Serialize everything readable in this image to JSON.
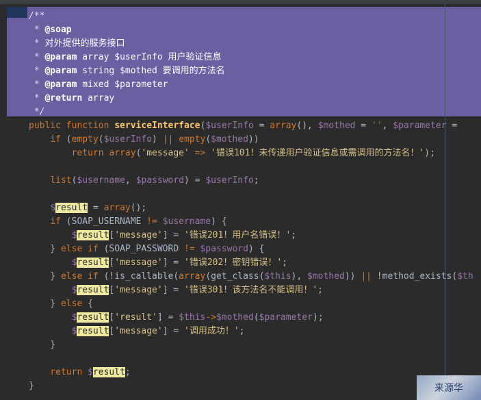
{
  "editor": {
    "lines": [
      [
        {
          "t": "/**",
          "c": "doc"
        }
      ],
      [
        {
          "t": " * ",
          "c": "star"
        },
        {
          "t": "@soap",
          "c": "tag"
        }
      ],
      [
        {
          "t": " * ",
          "c": "star"
        },
        {
          "t": "对外提供的服务接口",
          "c": "dtext"
        }
      ],
      [
        {
          "t": " * ",
          "c": "star"
        },
        {
          "t": "@param",
          "c": "tag"
        },
        {
          "t": " array $userInfo 用户验证信息",
          "c": "dtext"
        }
      ],
      [
        {
          "t": " * ",
          "c": "star"
        },
        {
          "t": "@param",
          "c": "tag"
        },
        {
          "t": " string $mothed 要调用的方法名",
          "c": "dtext"
        }
      ],
      [
        {
          "t": " * ",
          "c": "star"
        },
        {
          "t": "@param",
          "c": "tag"
        },
        {
          "t": " mixed $parameter",
          "c": "dtext"
        }
      ],
      [
        {
          "t": " * ",
          "c": "star"
        },
        {
          "t": "@return",
          "c": "tag"
        },
        {
          "t": " array",
          "c": "dtext"
        }
      ],
      [
        {
          "t": " */",
          "c": "doc"
        }
      ],
      [
        {
          "t": "public function ",
          "c": "kw"
        },
        {
          "t": "serviceInterface",
          "c": "fn"
        },
        {
          "t": "(",
          "c": "plain"
        },
        {
          "t": "$userInfo",
          "c": "var"
        },
        {
          "t": " = ",
          "c": "plain"
        },
        {
          "t": "array",
          "c": "kw"
        },
        {
          "t": "(), ",
          "c": "plain"
        },
        {
          "t": "$mothed",
          "c": "var"
        },
        {
          "t": " = ",
          "c": "plain"
        },
        {
          "t": "''",
          "c": "str"
        },
        {
          "t": ", ",
          "c": "plain"
        },
        {
          "t": "$parameter",
          "c": "var"
        },
        {
          "t": " = ",
          "c": "plain"
        }
      ],
      [
        {
          "t": "    ",
          "c": "plain"
        },
        {
          "t": "if",
          "c": "kw"
        },
        {
          "t": " (",
          "c": "plain"
        },
        {
          "t": "empty",
          "c": "kw"
        },
        {
          "t": "(",
          "c": "plain"
        },
        {
          "t": "$userInfo",
          "c": "var"
        },
        {
          "t": ") ",
          "c": "plain"
        },
        {
          "t": "||",
          "c": "punc"
        },
        {
          "t": " ",
          "c": "plain"
        },
        {
          "t": "empty",
          "c": "kw"
        },
        {
          "t": "(",
          "c": "plain"
        },
        {
          "t": "$mothed",
          "c": "var"
        },
        {
          "t": "))",
          "c": "plain"
        }
      ],
      [
        {
          "t": "        ",
          "c": "plain"
        },
        {
          "t": "return",
          "c": "kw"
        },
        {
          "t": " ",
          "c": "plain"
        },
        {
          "t": "array",
          "c": "kw"
        },
        {
          "t": "(",
          "c": "plain"
        },
        {
          "t": "'message'",
          "c": "str2"
        },
        {
          "t": " ",
          "c": "plain"
        },
        {
          "t": "=>",
          "c": "punc"
        },
        {
          "t": " ",
          "c": "plain"
        },
        {
          "t": "'错误101！未传递用户验证信息或需调用的方法名！'",
          "c": "str2"
        },
        {
          "t": ");",
          "c": "plain"
        }
      ],
      [],
      [
        {
          "t": "    ",
          "c": "plain"
        },
        {
          "t": "list",
          "c": "kw"
        },
        {
          "t": "(",
          "c": "plain"
        },
        {
          "t": "$username",
          "c": "var"
        },
        {
          "t": ", ",
          "c": "plain"
        },
        {
          "t": "$password",
          "c": "var"
        },
        {
          "t": ") = ",
          "c": "plain"
        },
        {
          "t": "$userInfo",
          "c": "var"
        },
        {
          "t": ";",
          "c": "plain"
        }
      ],
      [],
      [
        {
          "t": "    ",
          "c": "plain"
        },
        {
          "t": "$",
          "c": "var"
        },
        {
          "t": "result",
          "c": "hl"
        },
        {
          "t": " = ",
          "c": "plain"
        },
        {
          "t": "array",
          "c": "kw"
        },
        {
          "t": "();",
          "c": "plain"
        }
      ],
      [
        {
          "t": "    ",
          "c": "plain"
        },
        {
          "t": "if",
          "c": "kw"
        },
        {
          "t": " (SOAP_USERNAME ",
          "c": "plain"
        },
        {
          "t": "!=",
          "c": "punc"
        },
        {
          "t": " ",
          "c": "plain"
        },
        {
          "t": "$username",
          "c": "var"
        },
        {
          "t": ") {",
          "c": "plain"
        }
      ],
      [
        {
          "t": "        ",
          "c": "plain"
        },
        {
          "t": "$",
          "c": "var"
        },
        {
          "t": "result",
          "c": "hl"
        },
        {
          "t": "[",
          "c": "plain"
        },
        {
          "t": "'message'",
          "c": "str2"
        },
        {
          "t": "] = ",
          "c": "plain"
        },
        {
          "t": "'错误201！用户名错误！'",
          "c": "str2"
        },
        {
          "t": ";",
          "c": "plain"
        }
      ],
      [
        {
          "t": "    } ",
          "c": "plain"
        },
        {
          "t": "else if",
          "c": "kw"
        },
        {
          "t": " (SOAP_PASSWORD ",
          "c": "plain"
        },
        {
          "t": "!=",
          "c": "punc"
        },
        {
          "t": " ",
          "c": "plain"
        },
        {
          "t": "$password",
          "c": "var"
        },
        {
          "t": ") {",
          "c": "plain"
        }
      ],
      [
        {
          "t": "        ",
          "c": "plain"
        },
        {
          "t": "$",
          "c": "var"
        },
        {
          "t": "result",
          "c": "hl"
        },
        {
          "t": "[",
          "c": "plain"
        },
        {
          "t": "'message'",
          "c": "str2"
        },
        {
          "t": "] = ",
          "c": "plain"
        },
        {
          "t": "'错误202！密钥错误！'",
          "c": "str2"
        },
        {
          "t": ";",
          "c": "plain"
        }
      ],
      [
        {
          "t": "    } ",
          "c": "plain"
        },
        {
          "t": "else if",
          "c": "kw"
        },
        {
          "t": " (!is_callable(",
          "c": "plain"
        },
        {
          "t": "array",
          "c": "kw"
        },
        {
          "t": "(get_class(",
          "c": "plain"
        },
        {
          "t": "$this",
          "c": "var"
        },
        {
          "t": "), ",
          "c": "plain"
        },
        {
          "t": "$mothed",
          "c": "var"
        },
        {
          "t": ")) ",
          "c": "plain"
        },
        {
          "t": "||",
          "c": "punc"
        },
        {
          "t": " !method_exists(",
          "c": "plain"
        },
        {
          "t": "$th",
          "c": "var"
        }
      ],
      [
        {
          "t": "        ",
          "c": "plain"
        },
        {
          "t": "$",
          "c": "var"
        },
        {
          "t": "result",
          "c": "hl"
        },
        {
          "t": "[",
          "c": "plain"
        },
        {
          "t": "'message'",
          "c": "str2"
        },
        {
          "t": "] = ",
          "c": "plain"
        },
        {
          "t": "'错误301！该方法名不能调用！'",
          "c": "str2"
        },
        {
          "t": ";",
          "c": "plain"
        }
      ],
      [
        {
          "t": "    } ",
          "c": "plain"
        },
        {
          "t": "else",
          "c": "kw"
        },
        {
          "t": " {",
          "c": "plain"
        }
      ],
      [
        {
          "t": "        ",
          "c": "plain"
        },
        {
          "t": "$",
          "c": "var"
        },
        {
          "t": "result",
          "c": "hl"
        },
        {
          "t": "[",
          "c": "plain"
        },
        {
          "t": "'result'",
          "c": "str2"
        },
        {
          "t": "] = ",
          "c": "plain"
        },
        {
          "t": "$this",
          "c": "var"
        },
        {
          "t": "->",
          "c": "punc"
        },
        {
          "t": "$mothed",
          "c": "var"
        },
        {
          "t": "(",
          "c": "plain"
        },
        {
          "t": "$parameter",
          "c": "var"
        },
        {
          "t": ");",
          "c": "plain"
        }
      ],
      [
        {
          "t": "        ",
          "c": "plain"
        },
        {
          "t": "$",
          "c": "var"
        },
        {
          "t": "result",
          "c": "hl"
        },
        {
          "t": "[",
          "c": "plain"
        },
        {
          "t": "'message'",
          "c": "str2"
        },
        {
          "t": "] = ",
          "c": "plain"
        },
        {
          "t": "'调用成功！'",
          "c": "str2"
        },
        {
          "t": ";",
          "c": "plain"
        }
      ],
      [
        {
          "t": "    }",
          "c": "plain"
        }
      ],
      [],
      [
        {
          "t": "    ",
          "c": "plain"
        },
        {
          "t": "return",
          "c": "kw"
        },
        {
          "t": " ",
          "c": "plain"
        },
        {
          "t": "$",
          "c": "var"
        },
        {
          "t": "result",
          "c": "hl"
        },
        {
          "t": ";",
          "c": "plain"
        }
      ],
      [
        {
          "t": "}",
          "c": "plain"
        }
      ]
    ]
  },
  "watermark": {
    "text": "来源华"
  }
}
